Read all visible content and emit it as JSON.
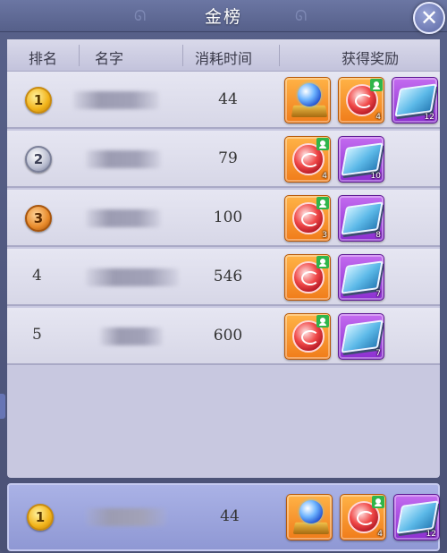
{
  "window": {
    "title": "金榜"
  },
  "header": {
    "rank": "排名",
    "name": "名字",
    "time": "消耗时间",
    "reward": "获得奖励"
  },
  "rows": [
    {
      "rank": "1",
      "medal": "gold",
      "time": "44",
      "rewards": [
        {
          "icon": "crystal-ball-icon",
          "frame": "orange",
          "count": ""
        },
        {
          "icon": "red-orb-icon",
          "frame": "orange",
          "count": "4",
          "bound": true
        },
        {
          "icon": "skill-book-icon",
          "frame": "purple",
          "count": "12"
        }
      ]
    },
    {
      "rank": "2",
      "medal": "silver",
      "time": "79",
      "rewards": [
        {
          "icon": "red-orb-icon",
          "frame": "orange",
          "count": "4",
          "bound": true
        },
        {
          "icon": "skill-book-icon",
          "frame": "purple",
          "count": "10"
        }
      ]
    },
    {
      "rank": "3",
      "medal": "bronze",
      "time": "100",
      "rewards": [
        {
          "icon": "red-orb-icon",
          "frame": "orange",
          "count": "3",
          "bound": true
        },
        {
          "icon": "skill-book-icon",
          "frame": "purple",
          "count": "8"
        }
      ]
    },
    {
      "rank": "4",
      "medal": "",
      "time": "546",
      "rewards": [
        {
          "icon": "red-orb-icon",
          "frame": "orange",
          "count": "",
          "bound": true
        },
        {
          "icon": "skill-book-icon",
          "frame": "purple",
          "count": "7"
        }
      ]
    },
    {
      "rank": "5",
      "medal": "",
      "time": "600",
      "rewards": [
        {
          "icon": "red-orb-icon",
          "frame": "orange",
          "count": "",
          "bound": true
        },
        {
          "icon": "skill-book-icon",
          "frame": "purple",
          "count": "7"
        }
      ]
    }
  ],
  "self_row": {
    "rank": "1",
    "medal": "gold",
    "time": "44",
    "rewards": [
      {
        "icon": "crystal-ball-icon",
        "frame": "orange",
        "count": ""
      },
      {
        "icon": "red-orb-icon",
        "frame": "orange",
        "count": "4",
        "bound": true
      },
      {
        "icon": "skill-book-icon",
        "frame": "purple",
        "count": "12"
      }
    ]
  },
  "colors": {
    "orange_frame": "#f07c1a",
    "purple_frame": "#8c2fd0",
    "bound_tag": "#2fb54a",
    "gold_medal": "#f2b41a"
  }
}
